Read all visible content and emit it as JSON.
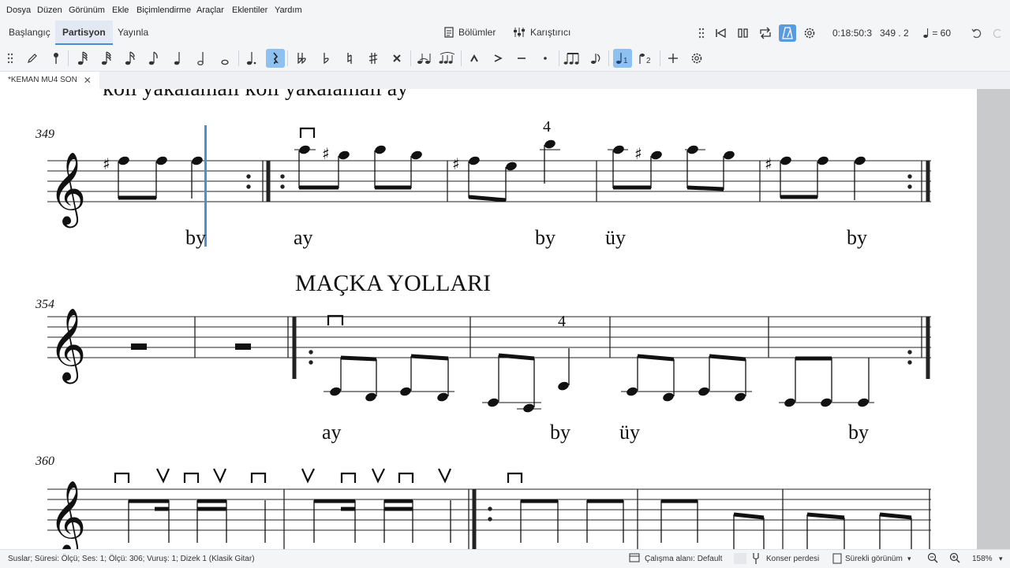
{
  "menu": [
    "Dosya",
    "Düzen",
    "Görünüm",
    "Ekle",
    "Biçimlendirme",
    "Araçlar",
    "Eklentiler",
    "Yardım"
  ],
  "tabs": {
    "home": "Başlangıç",
    "score": "Partisyon",
    "publish": "Yayınla"
  },
  "toolbar": {
    "parts": "Bölümler",
    "mixer": "Karıştırıcı",
    "playback_time": "0:18:50:3",
    "position": "349 . 2",
    "tempo": "= 60"
  },
  "document": {
    "tab_title": "*KEMAN MU4 SON"
  },
  "score": {
    "top_lyric_cut": "koli yakalamalı koli yakalamalı     ay",
    "system1": {
      "measure_number": "349",
      "fingering": "4",
      "lyrics": [
        "by",
        "ay",
        "by",
        "üy",
        "by"
      ]
    },
    "system2": {
      "measure_number": "354",
      "rehearsal_text": "MAÇKA YOLLARI",
      "fingering": "4",
      "lyrics": [
        "ay",
        "by",
        "üy",
        "by"
      ]
    },
    "system3": {
      "measure_number": "360"
    }
  },
  "status": {
    "selection": "Suslar; Süresi: Ölçü; Ses: 1; Ölçü: 306; Vuruş: 1; Dizek 1 (Klasik Gitar)",
    "workspace": "Çalışma alanı: Default",
    "concert_pitch": "Konser perdesi",
    "view_mode": "Sürekli görünüm",
    "zoom": "158%"
  },
  "colors": {
    "accent": "#4a8bd6",
    "selected_palette": "#8ec0f0",
    "playhead": "#4a90d9",
    "chrome_bg": "#f4f5f7"
  }
}
